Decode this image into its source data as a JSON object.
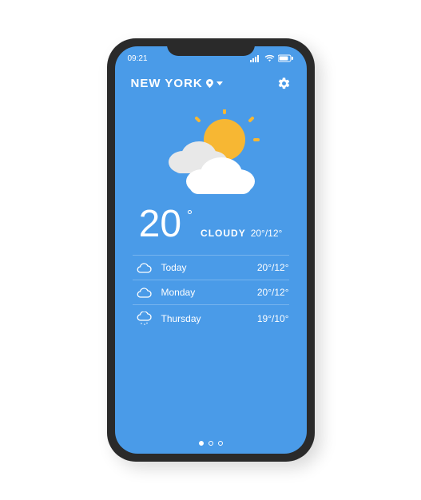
{
  "status": {
    "time": "09:21"
  },
  "header": {
    "location": "NEW YORK"
  },
  "current": {
    "temp": "20",
    "condition": "CLOUDY",
    "hilo": "20°/12°"
  },
  "forecast": [
    {
      "icon": "cloud",
      "day": "Today",
      "hilo": "20°/12°"
    },
    {
      "icon": "cloud",
      "day": "Monday",
      "hilo": "20°/12°"
    },
    {
      "icon": "rain",
      "day": "Thursday",
      "hilo": "19°/10°"
    }
  ],
  "pager": {
    "count": 3,
    "active": 0
  }
}
